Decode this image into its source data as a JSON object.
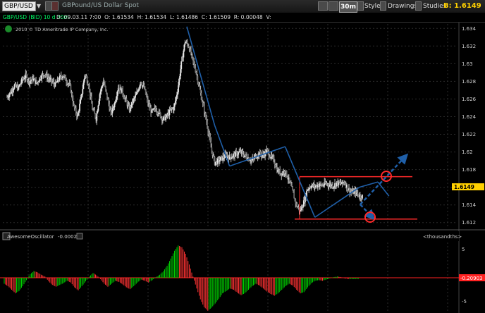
{
  "toolbar": {
    "symbol": "GBP/USD",
    "description": "GBPound/US Dollar Spot",
    "timeframe": "30m",
    "style_label": "Style",
    "drawings_label": "Drawings",
    "studies_label": "Studies",
    "bid_label": "B: 1.6149"
  },
  "info": {
    "symbol_line": "GBP/USD (BID) 10 d 30m",
    "date": "D: 09.03.11 7:00",
    "open": "O: 1.61534",
    "high": "H: 1.61534",
    "low": "L: 1.61486",
    "close": "C: 1.61509",
    "range": "R: 0.00048",
    "volume": "V:"
  },
  "copyright": "2010 © TD Ameritrade IP Company, Inc.",
  "indicator": {
    "name": "AwesomeOscillator",
    "value": "-0.0002",
    "units": "<thousandths>",
    "value_tag": "-0.20903",
    "ticks": [
      "5",
      "0",
      "-5"
    ]
  },
  "colors": {
    "up_bar": "#00cc00",
    "down_bar": "#ff3333",
    "trendline": "#1f5fa8",
    "channel": "#ff2a2a",
    "price_tag": "#ffd000"
  },
  "chart_data": {
    "type": "candlestick",
    "y_ticks": [
      "1.634",
      "1.632",
      "1.63",
      "1.628",
      "1.626",
      "1.624",
      "1.622",
      "1.62",
      "1.618",
      "1.616",
      "1.614",
      "1.612"
    ],
    "ylim": [
      1.6115,
      1.6345
    ],
    "last_price": "1.6149",
    "channel_levels": [
      1.6172,
      1.6124
    ],
    "close_series": [
      1.6262,
      1.6268,
      1.6275,
      1.6272,
      1.6281,
      1.6286,
      1.628,
      1.6283,
      1.6278,
      1.6285,
      1.6289,
      1.6284,
      1.628,
      1.6276,
      1.6283,
      1.6287,
      1.6281,
      1.6274,
      1.6252,
      1.624,
      1.6262,
      1.6288,
      1.6276,
      1.6249,
      1.6238,
      1.6266,
      1.628,
      1.6262,
      1.6243,
      1.6255,
      1.6274,
      1.6269,
      1.6258,
      1.6248,
      1.6258,
      1.6266,
      1.628,
      1.6272,
      1.6255,
      1.6245,
      1.6249,
      1.6244,
      1.6237,
      1.624,
      1.6247,
      1.625,
      1.627,
      1.63,
      1.6325,
      1.632,
      1.6305,
      1.629,
      1.627,
      1.625,
      1.623,
      1.6205,
      1.6188,
      1.619,
      1.6193,
      1.6196,
      1.6194,
      1.6196,
      1.6198,
      1.62,
      1.6196,
      1.6193,
      1.619,
      1.6195,
      1.6198,
      1.6196,
      1.6201,
      1.6195,
      1.619,
      1.6178,
      1.6176,
      1.6178,
      1.6168,
      1.6155,
      1.614,
      1.6133,
      1.6143,
      1.6158,
      1.6162,
      1.6161,
      1.6163,
      1.6162,
      1.6164,
      1.6163,
      1.6162,
      1.6165,
      1.6164,
      1.6166,
      1.6158,
      1.6154,
      1.6155,
      1.615
    ],
    "trendlines": [
      {
        "p1": [
          1.623,
          "c56"
        ],
        "p2": [
          1.6184,
          "c60"
        ]
      },
      {
        "p1": [
          1.6184,
          "c60"
        ],
        "p2": [
          1.6206,
          "c75"
        ]
      },
      {
        "p1": [
          1.6206,
          "c75"
        ],
        "p2": [
          1.6126,
          "c83"
        ]
      },
      {
        "p1": [
          1.6126,
          "c83"
        ],
        "p2": [
          1.616,
          "c95"
        ]
      },
      {
        "p1": [
          1.616,
          "c95"
        ],
        "p2": [
          1.6166,
          "c100"
        ]
      },
      {
        "p1": [
          1.6166,
          "c100"
        ],
        "p2": [
          1.615,
          "c103"
        ]
      }
    ],
    "oscillator_values": [
      -1.0,
      -1.4,
      -2.0,
      -2.6,
      -2.2,
      -1.4,
      -0.4,
      0.6,
      1.1,
      0.9,
      0.5,
      0.2,
      -0.6,
      -1.2,
      -1.5,
      -1.2,
      -0.9,
      -0.5,
      -0.8,
      -1.6,
      -2.1,
      -1.4,
      -0.6,
      0.2,
      0.8,
      0.4,
      -0.2,
      -1.0,
      -1.5,
      -1.0,
      -0.5,
      -0.7,
      -1.1,
      -1.6,
      -1.9,
      -1.4,
      -0.8,
      -0.3,
      -0.5,
      -0.8,
      -0.4,
      0.1,
      0.5,
      1.1,
      2.0,
      3.2,
      4.5,
      5.4,
      5.1,
      4.0,
      2.2,
      0.2,
      -1.8,
      -3.6,
      -4.9,
      -5.5,
      -5.0,
      -4.3,
      -3.5,
      -2.6,
      -2.2,
      -1.8,
      -2.0,
      -2.5,
      -2.9,
      -2.6,
      -2.0,
      -1.4,
      -1.0,
      -1.3,
      -1.8,
      -2.3,
      -2.7,
      -3.0,
      -2.6,
      -2.0,
      -1.4,
      -1.0,
      -1.3,
      -2.0,
      -2.6,
      -2.4,
      -1.6,
      -0.9,
      -0.5,
      -0.4,
      -0.5,
      -0.3,
      -0.1,
      0.1,
      0.2,
      0.1,
      -0.1,
      -0.2,
      -0.2,
      -0.2
    ]
  }
}
